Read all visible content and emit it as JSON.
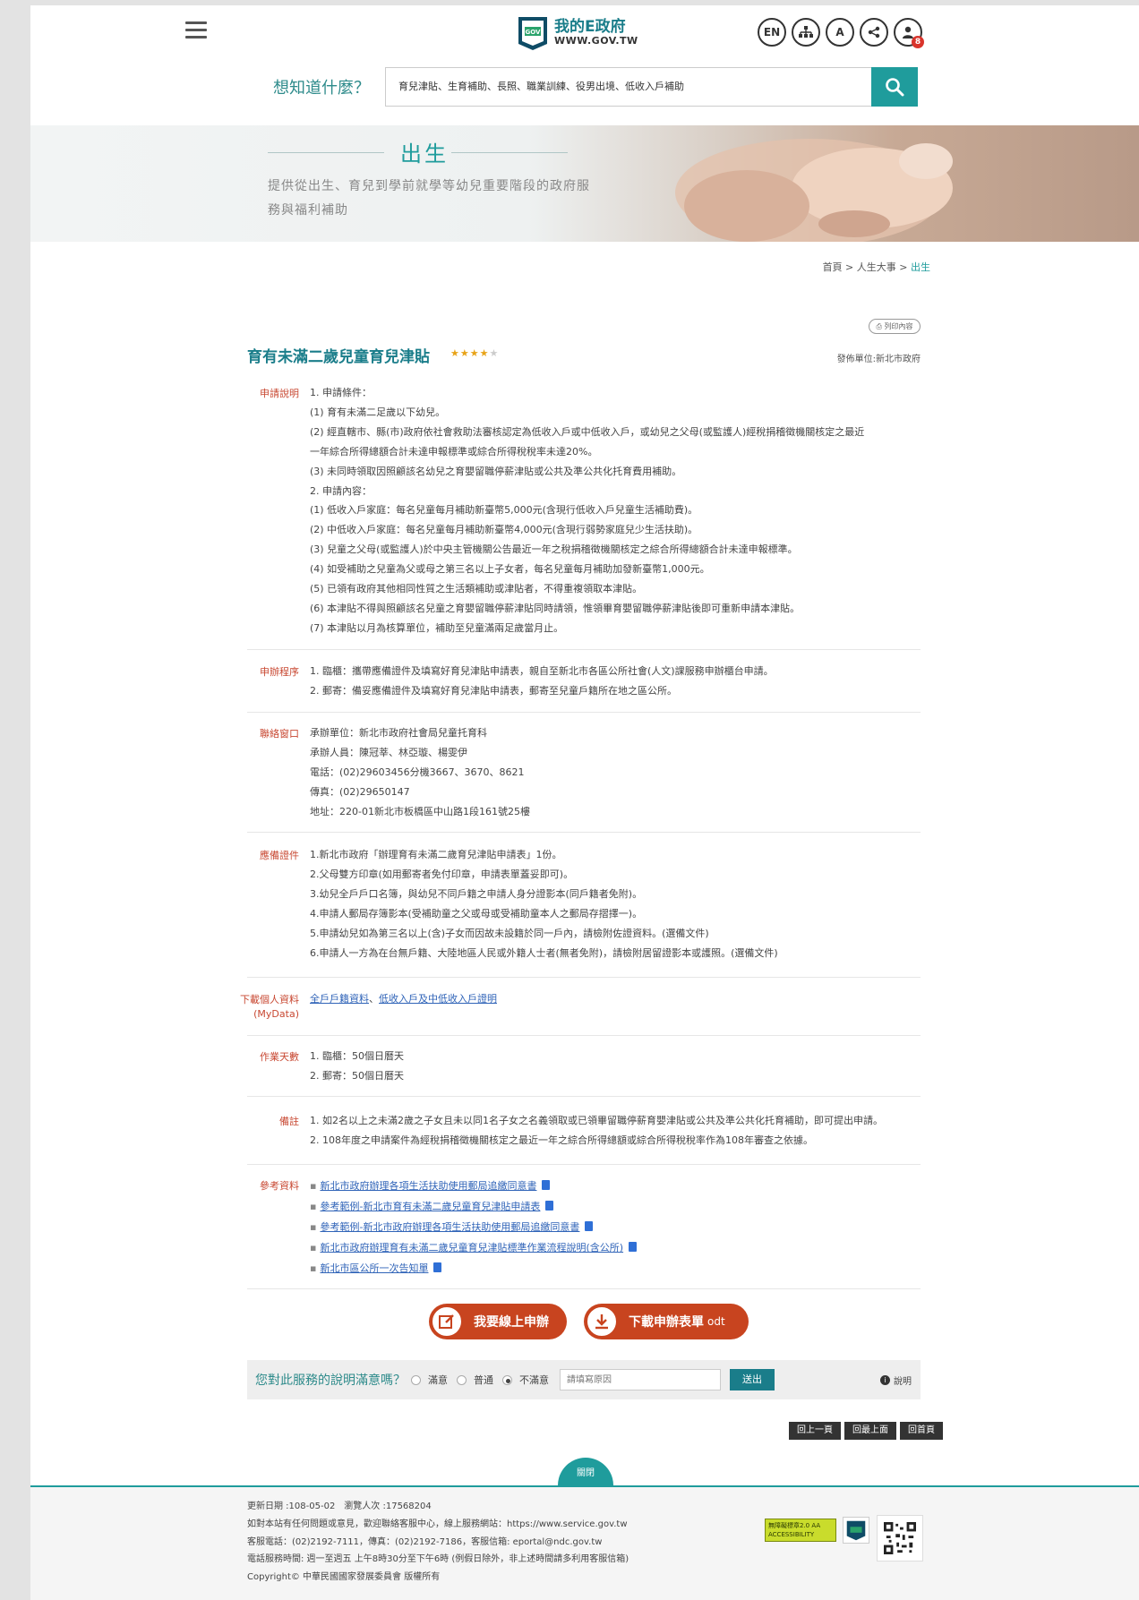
{
  "header": {
    "logo_name": "我的E政府",
    "logo_url": "WWW.GOV.TW",
    "tools": [
      "EN",
      "",
      "A",
      "",
      ""
    ],
    "notification_count": "8"
  },
  "search": {
    "label": "想知道什麼？",
    "value": "育兒津貼、生育補助、長照、職業訓練、役男出境、低收入戶補助"
  },
  "banner": {
    "title": "出生",
    "desc": "提供從出生、育兒到學前就學等幼兒重要階段的政府服務與福利補助"
  },
  "breadcrumb": {
    "home": "首頁",
    "sep": " > ",
    "parent": "人生大事",
    "current": "出生"
  },
  "print_label": "列印內容",
  "service": {
    "title": "育有未滿二歲兒童育兒津貼",
    "stars": "★★★★",
    "stars_off": "★",
    "publisher": "發佈單位:新北市政府"
  },
  "sections": {
    "apply_desc": {
      "label": "申請說明",
      "lines": [
        "1. 申請條件：",
        "(1) 育有未滿二足歲以下幼兒。",
        "(2) 經直轄市、縣(市)政府依社會救助法審核認定為低收入戶或中低收入戶，或幼兒之父母(或監護人)經稅捐稽徵機關核定之最近",
        "一年綜合所得總額合計未達申報標準或綜合所得稅稅率未達20%。",
        "(3) 未同時領取因照顧該名幼兒之育嬰留職停薪津貼或公共及準公共化托育費用補助。",
        "2. 申請內容：",
        "(1) 低收入戶家庭：每名兒童每月補助新臺幣5,000元(含現行低收入戶兒童生活補助費)。",
        "(2) 中低收入戶家庭：每名兒童每月補助新臺幣4,000元(含現行弱勢家庭兒少生活扶助)。",
        "(3) 兒童之父母(或監護人)於中央主管機關公告最近一年之稅捐稽徵機關核定之綜合所得總額合計未達申報標準。",
        "(4) 如受補助之兒童為父或母之第三名以上子女者，每名兒童每月補助加發新臺幣1,000元。",
        "(5) 已領有政府其他相同性質之生活類補助或津貼者，不得重複領取本津貼。",
        "(6) 本津貼不得與照顧該名兒童之育嬰留職停薪津貼同時請領，惟領畢育嬰留職停薪津貼後即可重新申請本津貼。",
        "(7) 本津貼以月為核算單位，補助至兒童滿兩足歲當月止。"
      ]
    },
    "procedure": {
      "label": "申辦程序",
      "lines": [
        "1. 臨櫃：攜帶應備證件及填寫好育兒津貼申請表，親自至新北市各區公所社會(人文)課服務申辦櫃台申請。",
        "2. 郵寄：備妥應備證件及填寫好育兒津貼申請表，郵寄至兒童戶籍所在地之區公所。"
      ]
    },
    "contact": {
      "label": "聯絡窗口",
      "lines": [
        "承辦單位：新北市政府社會局兒童托育科",
        "承辦人員：陳冠莘、林亞璇、楊雯伊",
        "電話：(02)29603456分機3667、3670、8621",
        "傳真：(02)29650147",
        "地址：220-01新北市板橋區中山路1段161號25樓"
      ]
    },
    "documents": {
      "label": "應備證件",
      "lines": [
        "1.新北市政府「辦理育有未滿二歲育兒津貼申請表」1份。",
        "2.父母雙方印章(如用郵寄者免付印章，申請表單蓋妥即可)。",
        "3.幼兒全戶戶口名簿，與幼兒不同戶籍之申請人身分證影本(同戶籍者免附)。",
        "4.申請人郵局存簿影本(受補助童之父或母或受補助童本人之郵局存摺擇一)。",
        "5.申請幼兒如為第三名以上(含)子女而因故未設籍於同一戶內，請檢附佐證資料。(選備文件)",
        "6.申請人一方為在台無戶籍、大陸地區人民或外籍人士者(無者免附)，請檢附居留證影本或護照。(選備文件)"
      ]
    },
    "mydata": {
      "label_1": "下載個人資料",
      "label_2": "(MyData)",
      "link_1": "全戶戶籍資料",
      "sep": "、",
      "link_2": "低收入戶及中低收入戶證明"
    },
    "days": {
      "label": "作業天數",
      "lines": [
        "1. 臨櫃：50個日曆天",
        "2. 郵寄：50個日曆天"
      ]
    },
    "remarks": {
      "label": "備註",
      "lines": [
        "1. 如2名以上之未滿2歲之子女且未以同1名子女之名義領取或已領畢留職停薪育嬰津貼或公共及準公共化托育補助，即可提出申請。",
        "2. 108年度之申請案件為經稅捐稽徵機關核定之最近一年之綜合所得總額或綜合所得稅稅率作為108年審查之依據。"
      ]
    },
    "references": {
      "label": "參考資料",
      "links": [
        "新北市政府辦理各項生活扶助使用郵局追繳同意書",
        "參考範例-新北市育有未滿二歲兒童育兒津貼申請表",
        "參考範例-新北市政府辦理各項生活扶助使用郵局追繳同意書",
        "新北市政府辦理育有未滿二歲兒童育兒津貼標準作業流程說明(含公所)",
        "新北市區公所一次告知單"
      ]
    }
  },
  "actions": {
    "online": "我要線上申辦",
    "download": "下載申辦表單",
    "download_format": "odt"
  },
  "survey": {
    "question": "您對此服務的說明滿意嗎？",
    "options": [
      "滿意",
      "普通",
      "不滿意"
    ],
    "selected": "不滿意",
    "placeholder": "請填寫原因",
    "submit": "送出",
    "help": "說明"
  },
  "nav": {
    "back": "回上一頁",
    "top": "回最上面",
    "home": "回首頁"
  },
  "footer": {
    "close": "關閉",
    "lines": [
      "更新日期 :108-05-02　瀏覽人次 :17568204",
      "如對本站有任何問題或意見，歡迎聯絡客服中心，線上服務網站：https://www.service.gov.tw",
      "客服電話：(02)2192-7111，傳真：(02)2192-7186，客服信箱: eportal@ndc.gov.tw",
      "電話服務時間: 週一至週五 上午8時30分至下午6時 (例假日除外，非上述時間請多利用客服信箱)",
      "Copyright© 中華民國國家發展委員會 版權所有"
    ],
    "accessibility": "無障礙標章2.0 AA",
    "accessibility_en": "ACCESSIBILITY"
  },
  "colors": {
    "teal": "#1f9c9c",
    "label_red": "#c84832",
    "action_orange": "#c8441f"
  }
}
